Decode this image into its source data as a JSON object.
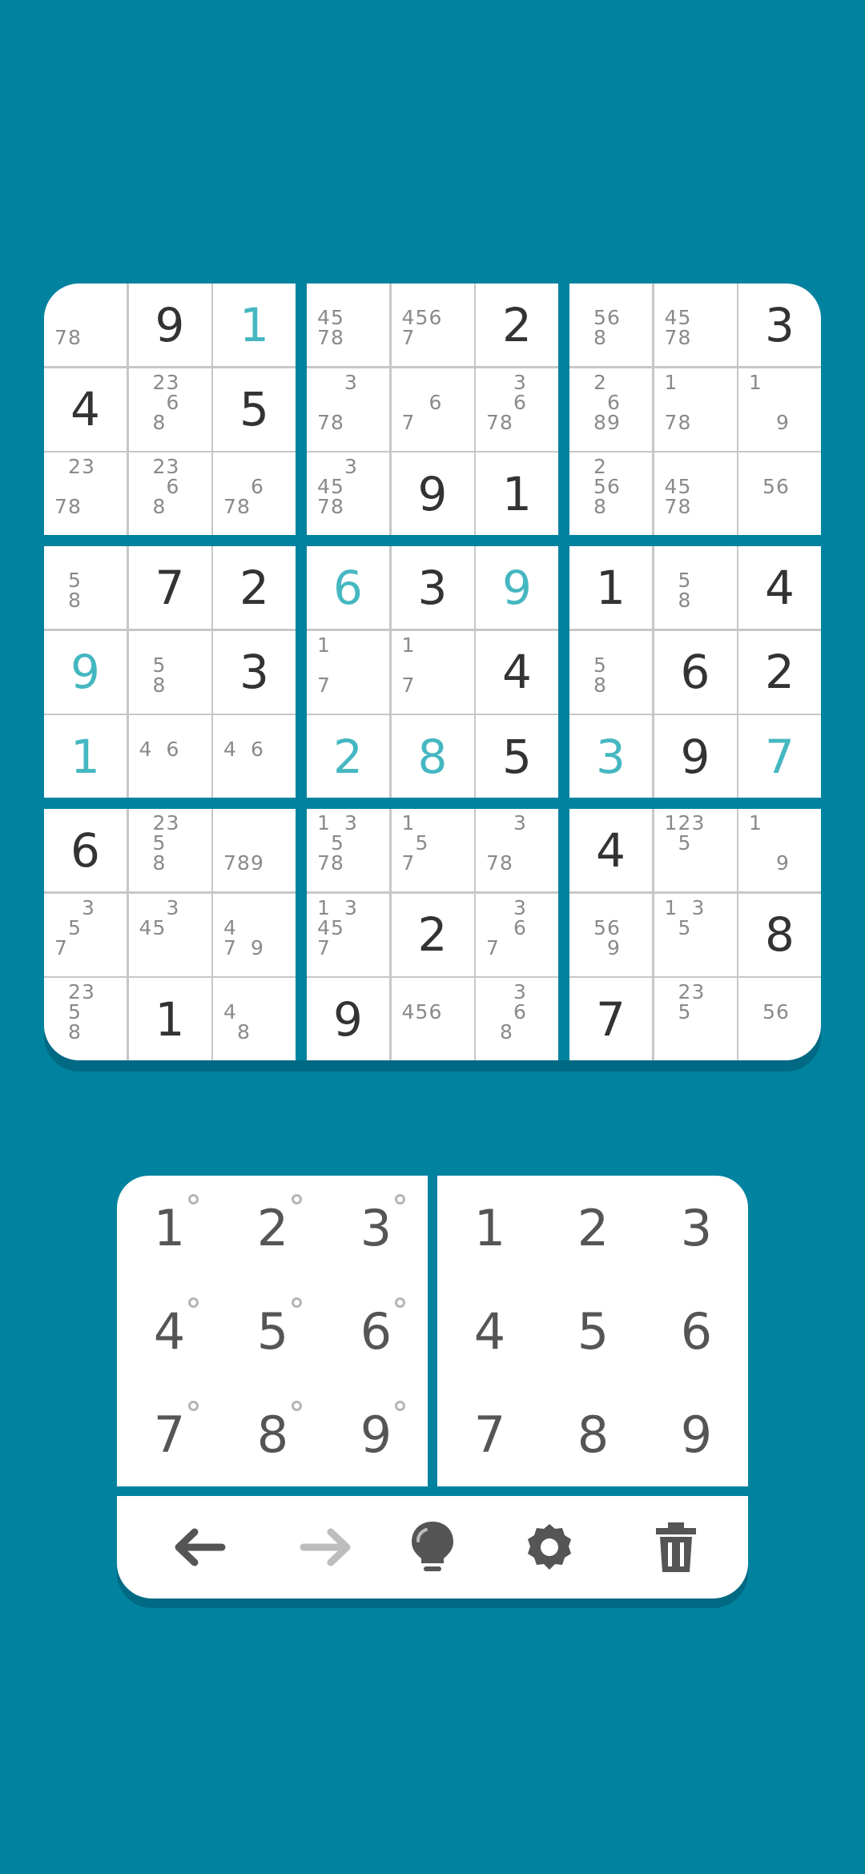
{
  "colors": {
    "background": "#01829f",
    "given_digit": "#333333",
    "user_digit": "#45b7c1",
    "note": "#8a8a8a",
    "pad_text": "#555555",
    "redo_disabled": "#bdbdbd"
  },
  "board": {
    "rows": [
      [
        {
          "n": [
            7,
            8
          ]
        },
        {
          "v": "9",
          "t": "given"
        },
        {
          "v": "1",
          "t": "user"
        },
        {
          "n": [
            4,
            5,
            7,
            8
          ]
        },
        {
          "n": [
            4,
            5,
            6,
            7
          ]
        },
        {
          "v": "2",
          "t": "given"
        },
        {
          "n": [
            5,
            6,
            8
          ]
        },
        {
          "n": [
            4,
            5,
            7,
            8
          ]
        },
        {
          "v": "3",
          "t": "given"
        }
      ],
      [
        {
          "v": "4",
          "t": "given"
        },
        {
          "n": [
            2,
            3,
            6,
            8
          ]
        },
        {
          "v": "5",
          "t": "given"
        },
        {
          "n": [
            3,
            7,
            8
          ]
        },
        {
          "n": [
            6,
            7
          ]
        },
        {
          "n": [
            3,
            6,
            7,
            8
          ]
        },
        {
          "n": [
            2,
            6,
            8,
            9
          ]
        },
        {
          "n": [
            1,
            7,
            8
          ]
        },
        {
          "n": [
            1,
            9
          ]
        }
      ],
      [
        {
          "n": [
            2,
            3,
            7,
            8
          ]
        },
        {
          "n": [
            2,
            3,
            6,
            8
          ]
        },
        {
          "n": [
            6,
            7,
            8
          ]
        },
        {
          "n": [
            3,
            4,
            5,
            7,
            8
          ]
        },
        {
          "v": "9",
          "t": "given"
        },
        {
          "v": "1",
          "t": "given"
        },
        {
          "n": [
            2,
            5,
            6,
            8
          ]
        },
        {
          "n": [
            4,
            5,
            7,
            8
          ]
        },
        {
          "n": [
            5,
            6
          ]
        }
      ],
      [
        {
          "n": [
            5,
            8
          ]
        },
        {
          "v": "7",
          "t": "given"
        },
        {
          "v": "2",
          "t": "given"
        },
        {
          "v": "6",
          "t": "user"
        },
        {
          "v": "3",
          "t": "given"
        },
        {
          "v": "9",
          "t": "user"
        },
        {
          "v": "1",
          "t": "given"
        },
        {
          "n": [
            5,
            8
          ]
        },
        {
          "v": "4",
          "t": "given"
        }
      ],
      [
        {
          "v": "9",
          "t": "user"
        },
        {
          "n": [
            5,
            8
          ]
        },
        {
          "v": "3",
          "t": "given"
        },
        {
          "n": [
            1,
            7
          ]
        },
        {
          "n": [
            1,
            7
          ]
        },
        {
          "v": "4",
          "t": "given"
        },
        {
          "n": [
            5,
            8
          ]
        },
        {
          "v": "6",
          "t": "given"
        },
        {
          "v": "2",
          "t": "given"
        }
      ],
      [
        {
          "v": "1",
          "t": "user"
        },
        {
          "n": [
            4,
            6
          ]
        },
        {
          "n": [
            4,
            6
          ]
        },
        {
          "v": "2",
          "t": "user"
        },
        {
          "v": "8",
          "t": "user"
        },
        {
          "v": "5",
          "t": "given"
        },
        {
          "v": "3",
          "t": "user"
        },
        {
          "v": "9",
          "t": "given"
        },
        {
          "v": "7",
          "t": "user"
        }
      ],
      [
        {
          "v": "6",
          "t": "given"
        },
        {
          "n": [
            2,
            3,
            5,
            8
          ]
        },
        {
          "n": [
            7,
            8,
            9
          ]
        },
        {
          "n": [
            1,
            3,
            5,
            7,
            8
          ]
        },
        {
          "n": [
            1,
            5,
            7
          ]
        },
        {
          "n": [
            3,
            7,
            8
          ]
        },
        {
          "v": "4",
          "t": "given"
        },
        {
          "n": [
            1,
            2,
            3,
            5
          ]
        },
        {
          "n": [
            1,
            9
          ]
        }
      ],
      [
        {
          "n": [
            3,
            5,
            7
          ]
        },
        {
          "n": [
            3,
            4,
            5
          ]
        },
        {
          "n": [
            4,
            7,
            9
          ]
        },
        {
          "n": [
            1,
            3,
            4,
            5,
            7
          ]
        },
        {
          "v": "2",
          "t": "given"
        },
        {
          "n": [
            3,
            6,
            7
          ]
        },
        {
          "n": [
            5,
            6,
            9
          ]
        },
        {
          "n": [
            1,
            3,
            5
          ]
        },
        {
          "v": "8",
          "t": "given"
        }
      ],
      [
        {
          "n": [
            2,
            3,
            5,
            8
          ]
        },
        {
          "v": "1",
          "t": "given"
        },
        {
          "n": [
            4,
            8
          ]
        },
        {
          "v": "9",
          "t": "given"
        },
        {
          "n": [
            4,
            5,
            6
          ]
        },
        {
          "n": [
            3,
            6,
            8
          ]
        },
        {
          "v": "7",
          "t": "given"
        },
        {
          "n": [
            2,
            3,
            5
          ]
        },
        {
          "n": [
            5,
            6
          ]
        }
      ]
    ]
  },
  "pad": {
    "notes_keys": [
      "1",
      "2",
      "3",
      "4",
      "5",
      "6",
      "7",
      "8",
      "9"
    ],
    "value_keys": [
      "1",
      "2",
      "3",
      "4",
      "5",
      "6",
      "7",
      "8",
      "9"
    ]
  },
  "toolbar": {
    "items": [
      {
        "name": "undo",
        "icon": "arrow-left-icon",
        "enabled": true
      },
      {
        "name": "redo",
        "icon": "arrow-right-icon",
        "enabled": false
      },
      {
        "name": "hint",
        "icon": "lightbulb-icon",
        "enabled": true
      },
      {
        "name": "settings",
        "icon": "gear-icon",
        "enabled": true
      },
      {
        "name": "clear",
        "icon": "trash-icon",
        "enabled": true
      }
    ]
  }
}
